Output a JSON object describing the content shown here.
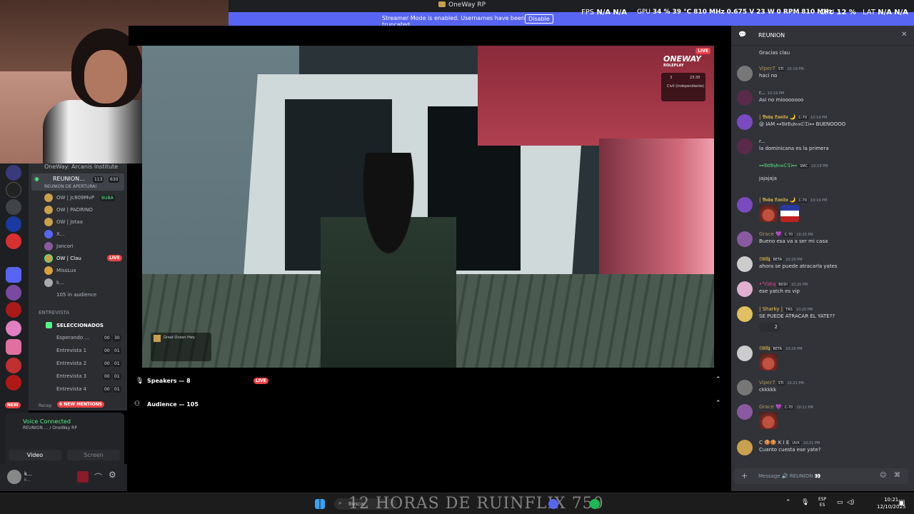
{
  "window": {
    "title": "OneWay RP"
  },
  "streamer_banner": {
    "message": "Streamer Mode is enabled. Usernames have been truncated.",
    "button": "Disable"
  },
  "overlay_stats": {
    "fps_label": "FPS",
    "fps_value": "N/A",
    "fps_value2": "N/A",
    "gpu_label": "GPU",
    "gpu_pct": "34 %",
    "gpu_temp": "39 °C",
    "gpu_clock": "810 MHz",
    "gpu_volt": "0.675 V",
    "gpu_power": "23 W",
    "gpu_rpm": "0 RPM",
    "gpu_mem": "810 MHz",
    "cpu_label": "CPU",
    "cpu_pct": "12 %",
    "lat_label": "LAT",
    "lat_value": "N/A",
    "lat_value2": "N/A"
  },
  "server": {
    "name": "OneWay: Arcanis Institute"
  },
  "channel": {
    "name": "REUNION...",
    "viewers": "113",
    "count": "630",
    "subtitle": "REUNION DE APERTURA!",
    "members": [
      {
        "name": "OW | Jc809MvP",
        "badge": "BUBA"
      },
      {
        "name": "OW | PADRINO"
      },
      {
        "name": "OW | Jotaa"
      },
      {
        "name": "X..."
      },
      {
        "name": "Jancori"
      },
      {
        "name": "OW | Clau",
        "live": "LIVE"
      },
      {
        "name": "MissLux"
      },
      {
        "name": "k..."
      }
    ],
    "audience": "105 in audience"
  },
  "categories": {
    "entrevista": "ENTREVISTA",
    "seleccionados": "SELECCIONADOS",
    "recepcion": "Recep"
  },
  "voice_channels": [
    {
      "name": "Esperando ...",
      "a": "00",
      "b": "30"
    },
    {
      "name": "Entrevista 1",
      "a": "00",
      "b": "01"
    },
    {
      "name": "Entrevista 2",
      "a": "00",
      "b": "01"
    },
    {
      "name": "Entrevista 3",
      "a": "00",
      "b": "01"
    },
    {
      "name": "Entrevista 4",
      "a": "00",
      "b": "01"
    }
  ],
  "new_mentions": "6 NEW MENTIONS",
  "new_badge": "NEW",
  "voice": {
    "status": "Voice Connected",
    "location": "REUNION ... / OneWay RP",
    "video_label": "Video",
    "screen_label": "Screen"
  },
  "user": {
    "name": "k...",
    "sub": "k..."
  },
  "stage": {
    "speakers_label": "Speakers — 8",
    "live": "LIVE",
    "audience_label": "Audience — 105"
  },
  "game": {
    "live": "LIVE",
    "logo": "ONEWAY",
    "logo_sub": "ROLEPLAY",
    "hud_id": "3",
    "hud_time": "23:30",
    "hud_job": "Civil (independiente)",
    "location": "Great Ocean Hwy"
  },
  "chat": {
    "title": "REUNION",
    "messages": [
      {
        "name": "",
        "time": "",
        "text": "Gracias clau",
        "color": "#dbdee1"
      },
      {
        "name": "Viper7",
        "tag": "STI",
        "time": "10:19 PM",
        "text": "haci no",
        "color": "#b5985a"
      },
      {
        "name": "r...",
        "tag": "",
        "time": "10:19 PM",
        "text": "Asi no miooooooo",
        "color": "#b5bac1"
      },
      {
        "name": "| 𝕭𝖆𝖇𝖞 𝕷𝖚𝖓𝖎𝖙𝖆 🌙",
        "tag": "C-70",
        "time": "10:19 PM",
        "text": "@ IAM ⊶𝔅𝔞𝔅𝔶𝔡𝔢𝔪𝔒𝔗𝔦⊷ BUENOOOO",
        "color": "#f0c64c"
      },
      {
        "name": "r...",
        "tag": "",
        "time": "",
        "text": "la dominicana es la primera",
        "color": "#b5bac1"
      },
      {
        "name": "⊶𝔅𝔞𝔅𝔶𝔡𝔢𝔪𝔒𝔗𝔦⊷",
        "tag": "SMC",
        "time": "10:19 PM",
        "text": "jajajaja",
        "color": "#57f287"
      },
      {
        "name": "| 𝕭𝖆𝖇𝖞 𝕷𝖚𝖓𝖎𝖙𝖆 🌙",
        "tag": "C-70",
        "time": "10:19 PM",
        "text": "",
        "color": "#f0c64c"
      },
      {
        "name": "Grace 💜",
        "tag": "C-70",
        "time": "10:20 PM",
        "text": "Bueno esa va a ser mi casa",
        "color": "#b5985a"
      },
      {
        "name": "𝕾𝖙𝖎𝖑𝖑𝖟",
        "tag": "BETA",
        "time": "10:20 PM",
        "text": "ahora se puede atracarla yates",
        "color": "#f0c64c"
      },
      {
        "name": "•°ƈơ𝔥ą",
        "tag": "BDDI",
        "time": "10:20 PM",
        "text": "ese yatch es vip",
        "color": "#eb459e"
      },
      {
        "name": "| Sharky |",
        "tag": "TRS",
        "time": "10:20 PM",
        "text": "SE PUEDE ATRACAR EL YATE??",
        "color": "#f0c64c"
      },
      {
        "name": "𝕾𝖙𝖎𝖑𝖑𝖟",
        "tag": "BETA",
        "time": "10:20 PM",
        "text": "",
        "color": "#f0c64c"
      },
      {
        "name": "Viper7",
        "tag": "STI",
        "time": "10:21 PM",
        "text": "ckkkkk",
        "color": "#b5985a"
      },
      {
        "name": "Grace 💜",
        "tag": "C-70",
        "time": "10:21 PM",
        "text": "",
        "color": "#b5985a"
      },
      {
        "name": "C 🍪🍪 K I E",
        "tag": "UVX",
        "time": "10:21 PM",
        "text": "Cuanto cuesta ese yate?",
        "color": "#dbdee1"
      }
    ],
    "reaction_count": "2",
    "input_placeholder": "Message 🔊 REUNION 👀"
  },
  "taskbar": {
    "search": "Buscar",
    "overlay_text": "12 HORAS DE RUINFLIX 750",
    "lang1": "ESP",
    "lang2": "ES",
    "time": "10:21",
    "date": "12/10/2025"
  }
}
